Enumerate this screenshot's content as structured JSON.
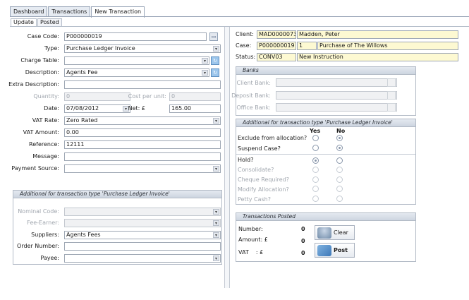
{
  "tabs": {
    "dashboard": "Dashboard",
    "transactions": "Transactions",
    "new_transaction": "New Transaction"
  },
  "subtabs": {
    "update": "Update",
    "posted": "Posted"
  },
  "form": {
    "case_code": {
      "label": "Case Code:",
      "value": "P000000019"
    },
    "type": {
      "label": "Type:",
      "value": "Purchase Ledger Invoice"
    },
    "charge_table": {
      "label": "Charge Table:",
      "value": ""
    },
    "description": {
      "label": "Description:",
      "value": "Agents Fee"
    },
    "extra_description": {
      "label": "Extra Description:",
      "value": ""
    },
    "quantity": {
      "label": "Quantity:",
      "value": "0"
    },
    "cost_per_unit": {
      "label": "Cost per unit:",
      "value": "0"
    },
    "date": {
      "label": "Date:",
      "value": "07/08/2012"
    },
    "net": {
      "label": "Net: £",
      "value": "165.00"
    },
    "vat_rate": {
      "label": "VAT Rate:",
      "value": "Zero Rated"
    },
    "vat_amount": {
      "label": "VAT Amount:",
      "value": "0.00"
    },
    "reference": {
      "label": "Reference:",
      "value": "12111"
    },
    "message": {
      "label": "Message:",
      "value": ""
    },
    "payment_source": {
      "label": "Payment Source:",
      "value": ""
    }
  },
  "additional_left": {
    "title": "Additional for transaction type 'Purchase Ledger Invoice'",
    "nominal_code": {
      "label": "Nominal Code:",
      "value": ""
    },
    "fee_earner": {
      "label": "Fee-Earner:",
      "value": ""
    },
    "suppliers": {
      "label": "Suppliers:",
      "value": "Agents Fees"
    },
    "order_number": {
      "label": "Order Number:",
      "value": ""
    },
    "payee": {
      "label": "Payee:",
      "value": ""
    }
  },
  "info": {
    "client_label": "Client:",
    "client_code": "MAD0000073",
    "client_name": "Madden, Peter",
    "case_label": "Case:",
    "case_code": "P000000019",
    "case_num": "1",
    "case_desc": "Purchase of The Willows",
    "status_label": "Status:",
    "status_code": "CONV03",
    "status_desc": "New Instruction"
  },
  "banks": {
    "title": "Banks",
    "client_bank": "Client Bank:",
    "deposit_bank": "Deposit Bank:",
    "office_bank": "Office Bank:"
  },
  "additional_right": {
    "title": "Additional for transaction type 'Purchase Ledger Invoice'",
    "yes": "Yes",
    "no": "No",
    "exclude": "Exclude from allocation?",
    "suspend": "Suspend Case?",
    "hold": "Hold?",
    "consolidate": "Consolidate?",
    "cheque": "Cheque Required?",
    "modify": "Modify Allocation?",
    "petty": "Petty Cash?"
  },
  "posted": {
    "title": "Transactions Posted",
    "number_label": "Number:",
    "number_value": "0",
    "amount_label": "Amount: £",
    "amount_value": "0",
    "vat_label": "VAT    : £",
    "vat_value": "0",
    "clear_label": "Clear",
    "post_label": "Post"
  },
  "icons": {
    "lookup": "lookup-icon",
    "dropdown": "chevron-down-icon",
    "refresh": "refresh-icon",
    "database": "database-icon",
    "post": "post-icon"
  },
  "colors": {
    "accent": "#5e90c2",
    "highlight": "#fdf9d2"
  }
}
